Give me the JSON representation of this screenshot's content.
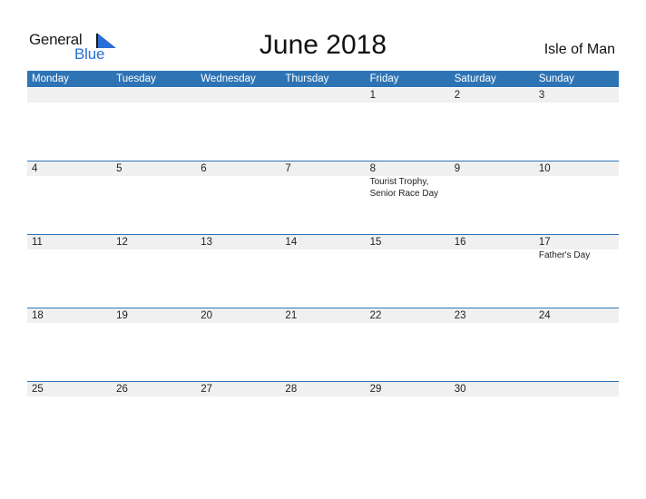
{
  "logo": {
    "line1": "General",
    "line2": "Blue",
    "accent_color": "#2a6fd6"
  },
  "title": "June 2018",
  "region": "Isle of Man",
  "header_color": "#2e74b5",
  "weekdays": [
    "Monday",
    "Tuesday",
    "Wednesday",
    "Thursday",
    "Friday",
    "Saturday",
    "Sunday"
  ],
  "weeks": [
    {
      "days": [
        {
          "num": "",
          "event": ""
        },
        {
          "num": "",
          "event": ""
        },
        {
          "num": "",
          "event": ""
        },
        {
          "num": "",
          "event": ""
        },
        {
          "num": "1",
          "event": ""
        },
        {
          "num": "2",
          "event": ""
        },
        {
          "num": "3",
          "event": ""
        }
      ]
    },
    {
      "days": [
        {
          "num": "4",
          "event": ""
        },
        {
          "num": "5",
          "event": ""
        },
        {
          "num": "6",
          "event": ""
        },
        {
          "num": "7",
          "event": ""
        },
        {
          "num": "8",
          "event": "Tourist Trophy, Senior Race Day"
        },
        {
          "num": "9",
          "event": ""
        },
        {
          "num": "10",
          "event": ""
        }
      ]
    },
    {
      "days": [
        {
          "num": "11",
          "event": ""
        },
        {
          "num": "12",
          "event": ""
        },
        {
          "num": "13",
          "event": ""
        },
        {
          "num": "14",
          "event": ""
        },
        {
          "num": "15",
          "event": ""
        },
        {
          "num": "16",
          "event": ""
        },
        {
          "num": "17",
          "event": "Father's Day"
        }
      ]
    },
    {
      "days": [
        {
          "num": "18",
          "event": ""
        },
        {
          "num": "19",
          "event": ""
        },
        {
          "num": "20",
          "event": ""
        },
        {
          "num": "21",
          "event": ""
        },
        {
          "num": "22",
          "event": ""
        },
        {
          "num": "23",
          "event": ""
        },
        {
          "num": "24",
          "event": ""
        }
      ]
    },
    {
      "days": [
        {
          "num": "25",
          "event": ""
        },
        {
          "num": "26",
          "event": ""
        },
        {
          "num": "27",
          "event": ""
        },
        {
          "num": "28",
          "event": ""
        },
        {
          "num": "29",
          "event": ""
        },
        {
          "num": "30",
          "event": ""
        },
        {
          "num": "",
          "event": ""
        }
      ]
    }
  ]
}
